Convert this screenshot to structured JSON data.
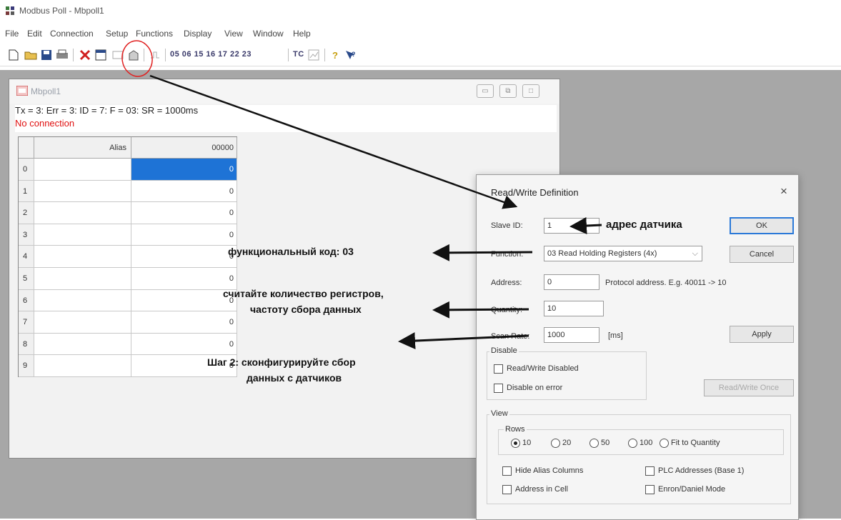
{
  "app": {
    "title": "Modbus Poll - Mbpoll1",
    "menu": [
      "File",
      "Edit",
      "Connection",
      "Setup",
      "Functions",
      "Display",
      "View",
      "Window",
      "Help"
    ],
    "toolbar_codes": "05 06 15 16 17 22 23",
    "toolbar_tc": "TC"
  },
  "child": {
    "title": "Mbpoll1",
    "status": "Tx = 3: Err = 3: ID = 7: F = 03: SR = 1000ms",
    "connection": "No connection",
    "grid": {
      "alias_header": "Alias",
      "value_header": "00000",
      "rows": [
        {
          "index": "0",
          "value": "0"
        },
        {
          "index": "1",
          "value": "0"
        },
        {
          "index": "2",
          "value": "0"
        },
        {
          "index": "3",
          "value": "0"
        },
        {
          "index": "4",
          "value": "0"
        },
        {
          "index": "5",
          "value": "0"
        },
        {
          "index": "6",
          "value": "0"
        },
        {
          "index": "7",
          "value": "0"
        },
        {
          "index": "8",
          "value": "0"
        },
        {
          "index": "9",
          "value": "0"
        }
      ]
    }
  },
  "dialog": {
    "title": "Read/Write Definition",
    "close": "×",
    "slave_id_label": "Slave ID:",
    "slave_id": "1",
    "function_label": "Function:",
    "function": "03 Read Holding Registers (4x)",
    "address_label": "Address:",
    "address": "0",
    "address_hint": "Protocol address. E.g. 40011 -> 10",
    "quantity_label": "Quantity:",
    "quantity": "10",
    "scan_rate_label": "Scan Rate:",
    "scan_rate": "1000",
    "scan_unit": "[ms]",
    "ok": "OK",
    "cancel": "Cancel",
    "apply": "Apply",
    "disable_group": "Disable",
    "rw_disabled": "Read/Write Disabled",
    "disable_on_error": "Disable on error",
    "rw_once": "Read/Write Once",
    "view_group": "View",
    "rows_group": "Rows",
    "rows_options": [
      "10",
      "20",
      "50",
      "100",
      "Fit to Quantity"
    ],
    "rows_selected": "10",
    "hide_alias": "Hide Alias Columns",
    "plc_addresses": "PLC Addresses (Base 1)",
    "address_in_cell": "Address in Cell",
    "enron_mode": "Enron/Daniel Mode"
  },
  "annotations": {
    "sensor_address": "адрес датчика",
    "function_code": "функциональный код: 03",
    "registers_line1": "считайте количество регистров,",
    "registers_line2": "частоту сбора данных",
    "step2_line1": "Шаг 2: сконфигурируйте сбор",
    "step2_line2": "данных с датчиков"
  },
  "colors": {
    "connection_error": "#e01010",
    "selection": "#1e73d6",
    "default_button_border": "#2b79d8",
    "annotation_circle": "#e02020"
  }
}
